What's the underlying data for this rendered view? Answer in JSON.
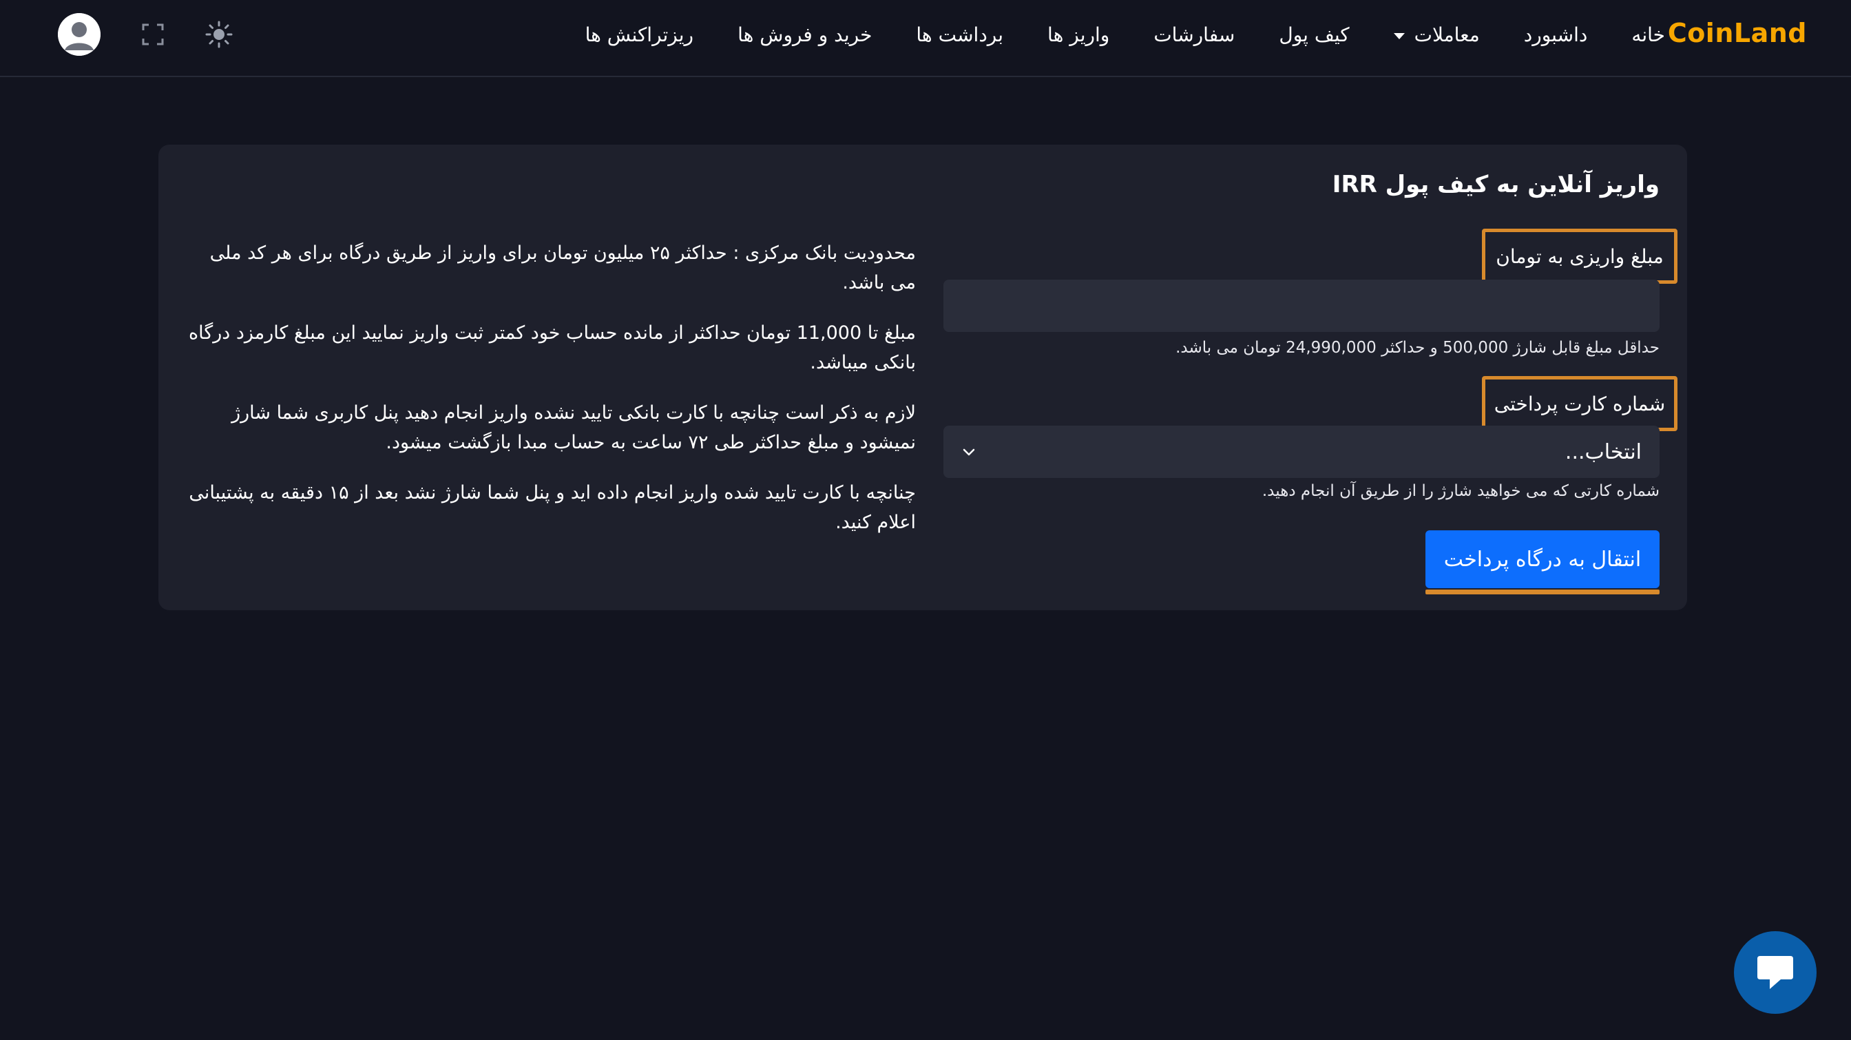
{
  "brand": "CoinLand",
  "nav": {
    "items": [
      {
        "label": "خانه"
      },
      {
        "label": "داشبورد"
      },
      {
        "label": "معاملات",
        "has_dropdown": true
      },
      {
        "label": "کیف پول"
      },
      {
        "label": "سفارشات"
      },
      {
        "label": "واریز ها"
      },
      {
        "label": "برداشت ها"
      },
      {
        "label": "خرید و فروش ها"
      },
      {
        "label": "ریزتراکنش ها"
      }
    ],
    "tools": [
      "sun-icon",
      "fullscreen-icon",
      "user-avatar"
    ]
  },
  "deposit": {
    "title": "واریز آنلاین به کیف پول IRR",
    "amount_label": "مبلغ واریزی به تومان",
    "amount_value": "",
    "amount_placeholder": "",
    "amount_hint": "حداقل مبلغ قابل شارژ 500,000 و حداکثر 24,990,000 تومان می باشد.",
    "card_label": "شماره کارت پرداختی",
    "card_select_value": "انتخاب...",
    "card_hint": "شماره کارتی که می خواهید شارژ را از طریق آن انجام دهید.",
    "submit_label": "انتقال به درگاه پرداخت"
  },
  "notes": [
    "محدودیت بانک مرکزی : حداکثر ۲۵ میلیون تومان برای واریز از طریق درگاه  برای هر کد ملی می باشد.",
    "مبلغ  تا 11,000 تومان حداکثر از مانده حساب خود کمتر ثبت واریز نمایید این مبلغ کارمزد درگاه بانکی میباشد.",
    "لازم به ذکر است چنانچه با کارت بانکی تایید نشده واریز انجام دهید پنل کاربری شما شارژ نمیشود و مبلغ حداکثر طی ۷۲ ساعت به حساب مبدا بازگشت میشود.",
    "چنانچه با کارت تایید شده واریز انجام داده اید و پنل شما شارژ نشد بعد از ۱۵ دقیقه به پشتیبانی اعلام کنید."
  ],
  "colors": {
    "background": "#12141f",
    "card": "#1e202c",
    "input": "#2a2d3a",
    "brand": "#f7a600",
    "primary": "#0d6efd",
    "highlight": "#d88a2c",
    "chat": "#0a5eaa"
  }
}
